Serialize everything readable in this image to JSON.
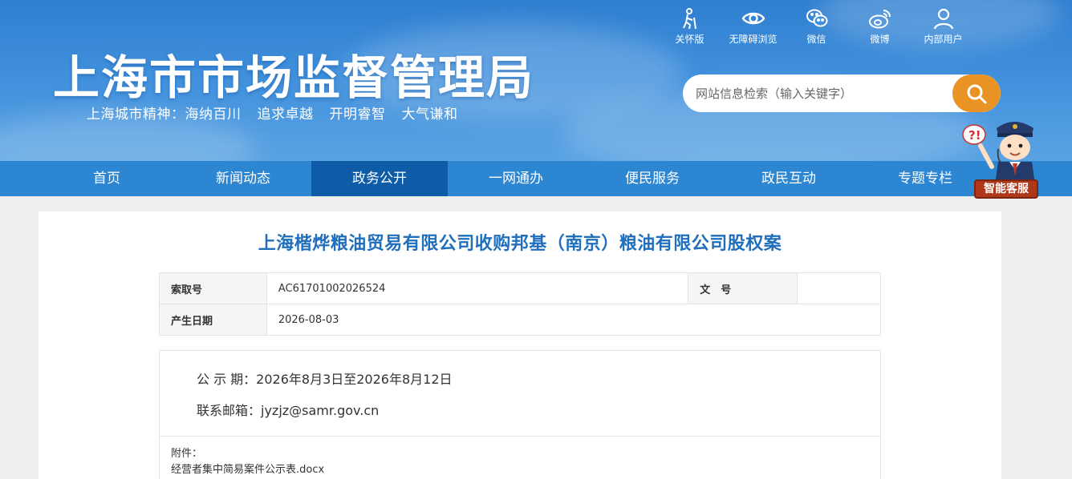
{
  "header": {
    "title": "上海市市场监督管理局",
    "slogan": [
      "上海城市精神：海纳百川",
      "追求卓越",
      "开明睿智",
      "大气谦和"
    ]
  },
  "tools": [
    {
      "label": "关怀版",
      "icon": "elderly-care-icon"
    },
    {
      "label": "无障碍浏览",
      "icon": "eye-icon"
    },
    {
      "label": "微信",
      "icon": "wechat-icon"
    },
    {
      "label": "微博",
      "icon": "weibo-icon"
    },
    {
      "label": "内部用户",
      "icon": "user-icon"
    }
  ],
  "search": {
    "placeholder": "网站信息检索（输入关键字）",
    "button_icon": "search-icon"
  },
  "nav": {
    "items": [
      "首页",
      "新闻动态",
      "政务公开",
      "一网通办",
      "便民服务",
      "政民互动",
      "专题专栏"
    ],
    "active": "政务公开"
  },
  "assistant": {
    "label": "智能客服",
    "icon": "customer-service-mascot-icon"
  },
  "article": {
    "title": "上海楷烨粮油贸易有限公司收购邦基（南京）粮油有限公司股权案",
    "meta": {
      "index_label": "索取号",
      "index_value": "AC61701002026524",
      "docno_label": "文　号",
      "docno_value": "",
      "date_label": "产生日期",
      "date_value": "2026-08-03"
    },
    "lines": [
      "公 示 期：2026年8月3日至2026年8月12日",
      "联系邮箱：jyzjz@samr.gov.cn"
    ],
    "attachment_label": "附件：",
    "attachment_file": "经营者集中简易案件公示表.docx"
  },
  "colors": {
    "header_blue": "#3f8fdc",
    "nav_blue": "#2c86d2",
    "nav_active": "#0e5ba8",
    "search_orange": "#e99324",
    "title_blue": "#1f6fbd"
  }
}
